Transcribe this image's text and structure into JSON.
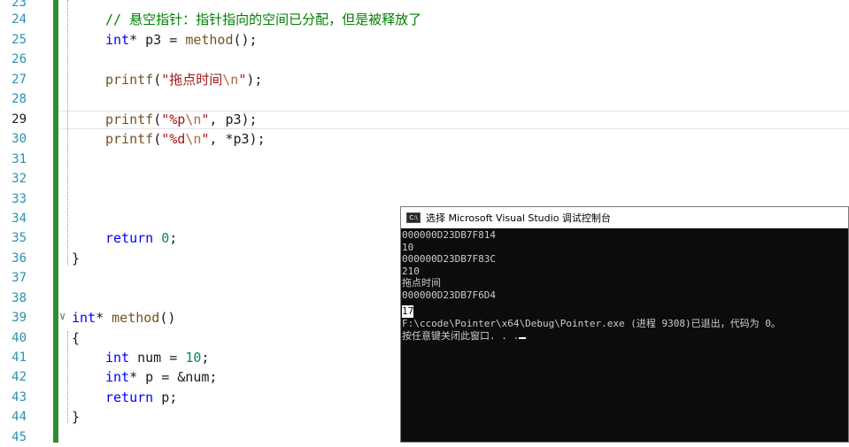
{
  "editor": {
    "lines": [
      {
        "num": "23",
        "text": ""
      },
      {
        "num": "24",
        "text": "// 悬空指针：指针指向的空间已分配，但是被释放了"
      },
      {
        "num": "25",
        "text": "int* p3 = method();"
      },
      {
        "num": "26",
        "text": ""
      },
      {
        "num": "27",
        "text": "printf(\"拖点时间\\n\");"
      },
      {
        "num": "28",
        "text": ""
      },
      {
        "num": "29",
        "text": "printf(\"%p\\n\", p3);"
      },
      {
        "num": "30",
        "text": "printf(\"%d\\n\", *p3);"
      },
      {
        "num": "31",
        "text": ""
      },
      {
        "num": "32",
        "text": ""
      },
      {
        "num": "33",
        "text": ""
      },
      {
        "num": "34",
        "text": ""
      },
      {
        "num": "35",
        "text": "return 0;"
      },
      {
        "num": "36",
        "text": "}"
      },
      {
        "num": "37",
        "text": ""
      },
      {
        "num": "38",
        "text": ""
      },
      {
        "num": "39",
        "text": "int* method()"
      },
      {
        "num": "40",
        "text": "{"
      },
      {
        "num": "41",
        "text": "int num = 10;"
      },
      {
        "num": "42",
        "text": "int* p = &num;"
      },
      {
        "num": "43",
        "text": "return p;"
      },
      {
        "num": "44",
        "text": "}"
      },
      {
        "num": "45",
        "text": ""
      }
    ],
    "current_line": "29"
  },
  "console": {
    "title": "选择 Microsoft Visual Studio 调试控制台",
    "icon": "console-app-icon",
    "output": [
      "000000D23DB7F814",
      "10",
      "000000D23DB7F83C",
      "210",
      "拖点时间",
      "000000D23DB7F6D4",
      "17",
      "",
      "F:\\ccode\\Pointer\\x64\\Debug\\Pointer.exe (进程 9308)已退出，代码为 0。",
      "按任意键关闭此窗口. . ."
    ]
  },
  "colors": {
    "keyword": "#0000ff",
    "string": "#a31515",
    "comment": "#008000",
    "number": "#098658",
    "line_number": "#2b91af",
    "change_bar": "#2f8b2f",
    "console_bg": "#0c0c0c"
  }
}
